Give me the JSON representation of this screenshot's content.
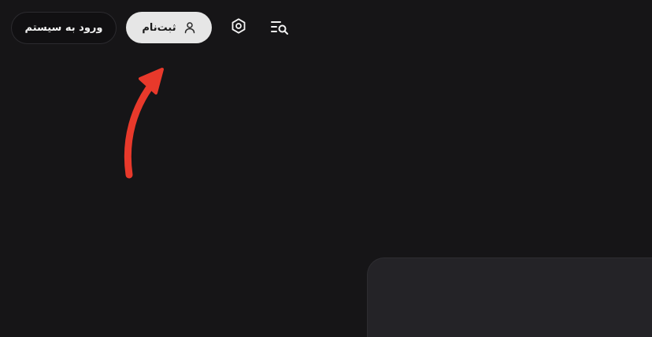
{
  "header": {
    "login_label": "ورود به سیستم",
    "signup_label": "ثبت‌نام",
    "settings_icon": "gear-icon",
    "search_list_icon": "list-search-icon",
    "user_icon": "user-icon"
  },
  "annotation": {
    "arrow_color": "#e8392b"
  },
  "colors": {
    "background": "#161517",
    "signup_bg": "#e6e6e6",
    "panel_bg": "#242327"
  }
}
